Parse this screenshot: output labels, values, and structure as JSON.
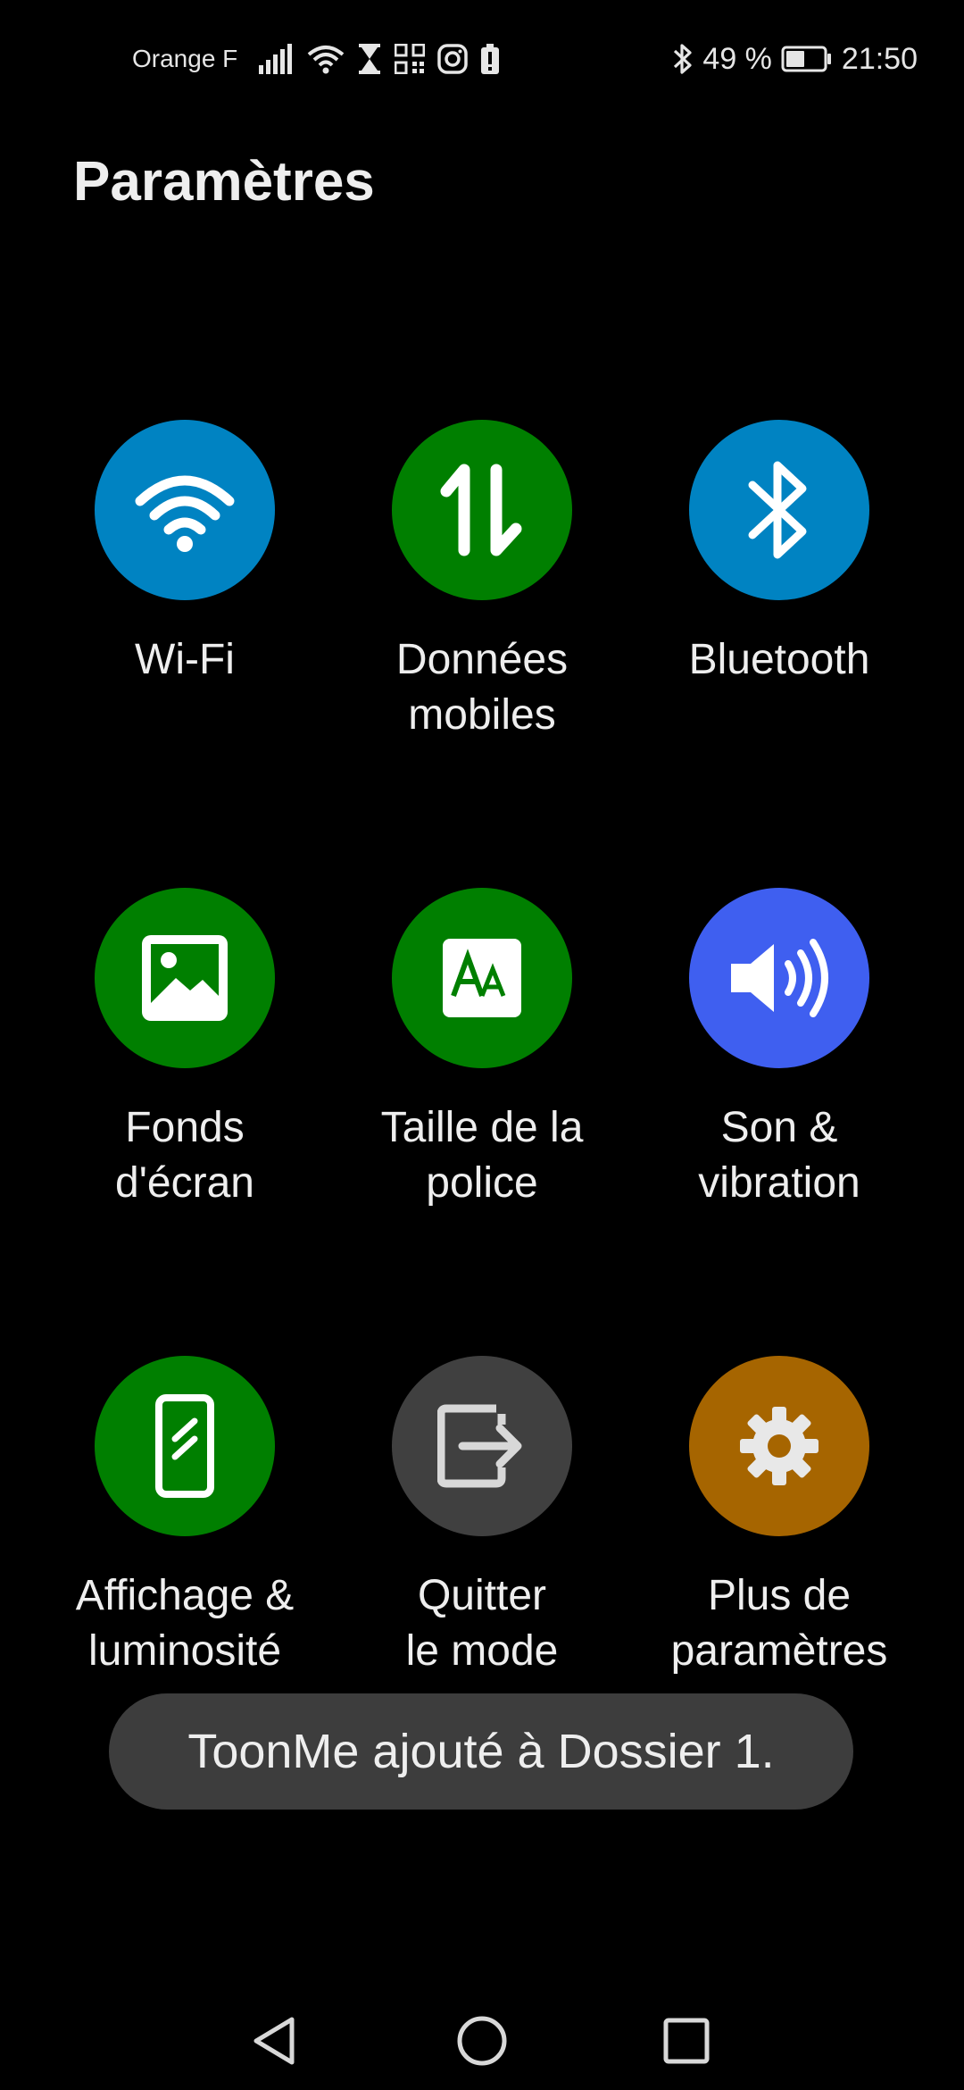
{
  "status_bar": {
    "carrier": "Orange F",
    "battery_percent": "49 %",
    "time": "21:50",
    "icons": [
      "signal-icon",
      "wifi-icon",
      "hourglass-icon",
      "qr-code-icon",
      "instagram-icon",
      "battery-alert-icon",
      "bluetooth-icon",
      "battery-icon"
    ]
  },
  "header": {
    "title": "Paramètres"
  },
  "tiles": [
    {
      "label": "Wi-Fi",
      "icon": "wifi-icon",
      "color": "#0083c2"
    },
    {
      "label": "Données\nmobiles",
      "icon": "mobile-data-icon",
      "color": "#007f00"
    },
    {
      "label": "Bluetooth",
      "icon": "bluetooth-icon",
      "color": "#0083c2"
    },
    {
      "label": "Fonds\nd'écran",
      "icon": "wallpaper-icon",
      "color": "#007f00"
    },
    {
      "label": "Taille de la\npolice",
      "icon": "font-size-icon",
      "color": "#007f00"
    },
    {
      "label": "Son &\nvibration",
      "icon": "volume-icon",
      "color": "#3f5ff0"
    },
    {
      "label": "Affichage &\nluminosité",
      "icon": "display-icon",
      "color": "#007f00"
    },
    {
      "label": "Quitter\nle mode",
      "icon": "exit-icon",
      "color": "#404040"
    },
    {
      "label": "Plus de\nparamètres",
      "icon": "gear-icon",
      "color": "#a66500"
    }
  ],
  "toast": {
    "message": "ToonMe ajouté à Dossier 1."
  },
  "nav_bar": {
    "buttons": [
      "back-icon",
      "home-icon",
      "recents-icon"
    ]
  }
}
